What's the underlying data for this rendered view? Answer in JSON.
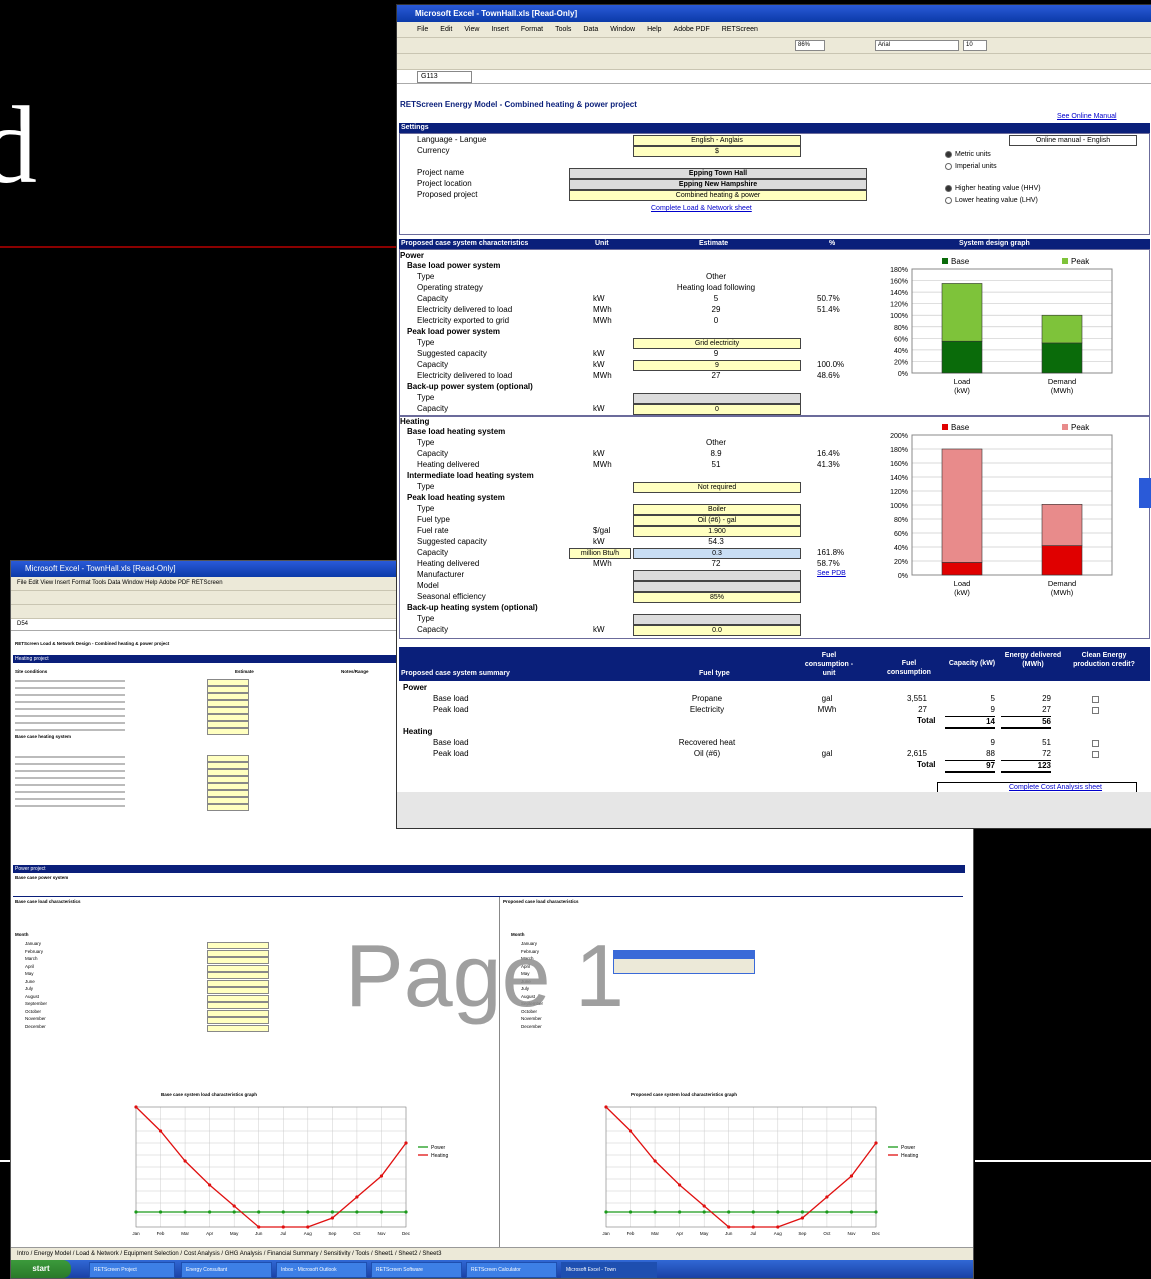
{
  "slide": {
    "letter": "d"
  },
  "front": {
    "title": "Microsoft Excel - TownHall.xls [Read-Only]",
    "menus": [
      "File",
      "Edit",
      "View",
      "Insert",
      "Format",
      "Tools",
      "Data",
      "Window",
      "Help",
      "Adobe PDF",
      "RETScreen"
    ],
    "zoom": "86%",
    "font": "Arial",
    "font_size": "10",
    "cell_ref": "G113",
    "sheet_title": "RETScreen Energy Model - Combined heating & power project",
    "online_manual_link": "See Online Manual",
    "settings": {
      "header": "Settings",
      "language_label": "Language - Langue",
      "language_value": "English - Anglais",
      "currency_label": "Currency",
      "currency_value": "$",
      "online_manual_value": "Online manual - English",
      "metric": "Metric units",
      "imperial": "Imperial units",
      "hhv": "Higher heating value (HHV)",
      "lhv": "Lower heating value (LHV)",
      "project_name_label": "Project name",
      "project_name": "Epping Town Hall",
      "project_location_label": "Project location",
      "project_location": "Epping New Hampshire",
      "proposed_project_label": "Proposed project",
      "proposed_project": "Combined heating & power",
      "complete_link": "Complete Load & Network sheet"
    },
    "characteristics": {
      "header": "Proposed case system characteristics",
      "col_unit": "Unit",
      "col_estimate": "Estimate",
      "col_pct": "%",
      "col_graph": "System design graph",
      "power_label": "Power",
      "base_power": "Base load power system",
      "type_label": "Type",
      "type_value": "Other",
      "op_strategy_label": "Operating strategy",
      "op_strategy_value": "Heating load following",
      "capacity_label": "Capacity",
      "unit_kw": "kW",
      "base_capacity": "5",
      "base_capacity_pct": "50.7%",
      "elec_delivered_label": "Electricity delivered to load",
      "unit_mwh": "MWh",
      "elec_delivered": "29",
      "elec_delivered_pct": "51.4%",
      "elec_exported_label": "Electricity exported to grid",
      "elec_exported": "0",
      "peak_power": "Peak load power system",
      "peak_type": "Grid electricity",
      "suggested_capacity_label": "Suggested capacity",
      "peak_suggested": "9",
      "peak_capacity": "9",
      "peak_capacity_pct": "100.0%",
      "peak_elec": "27",
      "peak_elec_pct": "48.6%",
      "backup_power": "Back-up power system (optional)",
      "backup_capacity": "0",
      "heating_label": "Heating",
      "base_heating": "Base load heating system",
      "base_heat_type": "Other",
      "base_heat_capacity": "8.9",
      "base_heat_capacity_pct": "16.4%",
      "heating_delivered_label": "Heating delivered",
      "base_heat_delivered": "51",
      "base_heat_delivered_pct": "41.3%",
      "intermediate_heating": "Intermediate load heating system",
      "intermediate_type": "Not required",
      "peak_heating": "Peak load heating system",
      "peak_heat_type": "Boiler",
      "fuel_type_label": "Fuel type",
      "fuel_type_value": "Oil (#6) - gal",
      "fuel_rate_label": "Fuel rate",
      "fuel_rate_unit": "$/gal",
      "fuel_rate_value": "1.900",
      "peak_heat_suggested": "54.3",
      "peak_heat_capacity_unit": "million Btu/h",
      "peak_heat_capacity": "0.3",
      "peak_heat_capacity_pct": "161.8%",
      "peak_heat_delivered": "72",
      "peak_heat_delivered_pct": "58.7%",
      "see_pdb": "See PDB",
      "manufacturer_label": "Manufacturer",
      "model_label": "Model",
      "seasonal_eff_label": "Seasonal efficiency",
      "seasonal_eff_value": "85%",
      "backup_heating": "Back-up heating system (optional)",
      "backup_heat_unit": "kW",
      "backup_heat_capacity": "0.0"
    },
    "power_chart": {
      "legend": [
        "Base",
        "Peak"
      ],
      "yticks": [
        "180%",
        "160%",
        "140%",
        "120%",
        "100%",
        "80%",
        "60%",
        "40%",
        "20%",
        "0%"
      ],
      "categories": [
        "Load\n(kW)",
        "Demand\n(MWh)"
      ],
      "cat_labels": [
        [
          "Load",
          "(kW)"
        ],
        [
          "Demand",
          "(MWh)"
        ]
      ],
      "base_pct": [
        55,
        52
      ],
      "peak_pct": [
        100,
        48
      ],
      "colors": {
        "base": "#0a6b0a",
        "peak": "#7ec33a"
      }
    },
    "heating_chart": {
      "legend": [
        "Base",
        "Peak"
      ],
      "yticks": [
        "200%",
        "180%",
        "160%",
        "140%",
        "120%",
        "100%",
        "80%",
        "60%",
        "40%",
        "20%",
        "0%"
      ],
      "cat_labels": [
        [
          "Load",
          "(kW)"
        ],
        [
          "Demand",
          "(MWh)"
        ]
      ],
      "base_pct": [
        18,
        42
      ],
      "peak_pct": [
        162,
        59
      ],
      "colors": {
        "base": "#e00000",
        "peak": "#e88b8b"
      }
    },
    "summary": {
      "header": "Proposed case system summary",
      "col_fuel_type": "Fuel type",
      "col_fuel_unit": "Fuel consumption - unit",
      "col_fuel_cons": "Fuel consumption",
      "col_capacity": "Capacity (kW)",
      "col_energy": "Energy delivered (MWh)",
      "col_clean": "Clean Energy production credit?",
      "power_label": "Power",
      "heating_label": "Heating",
      "total_label": "Total",
      "rows_power": [
        {
          "label": "Base load",
          "fuel": "Propane",
          "unit": "gal",
          "cons": "3,551",
          "cap": "5",
          "energy": "29"
        },
        {
          "label": "Peak load",
          "fuel": "Electricity",
          "unit": "MWh",
          "cons": "27",
          "cap": "9",
          "energy": "27"
        }
      ],
      "power_total": {
        "cap": "14",
        "energy": "56"
      },
      "rows_heating": [
        {
          "label": "Base load",
          "fuel": "Recovered heat",
          "unit": "",
          "cons": "",
          "cap": "9",
          "energy": "51"
        },
        {
          "label": "Peak load",
          "fuel": "Oil (#6)",
          "unit": "gal",
          "cons": "2,615",
          "cap": "88",
          "energy": "72"
        }
      ],
      "heating_total": {
        "cap": "97",
        "energy": "123"
      },
      "cost_link": "Complete Cost Analysis sheet"
    }
  },
  "back": {
    "title": "Microsoft Excel - TownHall.xls [Read-Only]",
    "cell_ref": "D54",
    "sheet_title": "RETScreen Load & Network Design - Combined heating & power project",
    "heating_project": "Heating project",
    "site_conditions": "Site conditions",
    "estimate": "Estimate",
    "notes_range": "Notes/Range",
    "base_heating_system": "Base case heating system",
    "power_project": "Power project",
    "base_power_system": "Base case power system",
    "base_load_char": "Base case load characteristics",
    "proposed_load_char": "Proposed case load characteristics",
    "month_label": "Month",
    "months": [
      "January",
      "February",
      "March",
      "April",
      "May",
      "June",
      "July",
      "August",
      "September",
      "October",
      "November",
      "December"
    ],
    "watermark": "Page 1",
    "base_graph_title": "Base case system load characteristics graph",
    "proposed_graph_title": "Proposed case system load characteristics graph",
    "legend": [
      "Power",
      "Heating"
    ],
    "month_abbr": [
      "Jan",
      "Feb",
      "Mar",
      "Apr",
      "May",
      "Jun",
      "Jul",
      "Aug",
      "Sep",
      "Oct",
      "Nov",
      "Dec"
    ],
    "line_data": {
      "power": [
        5,
        5,
        5,
        5,
        5,
        5,
        5,
        5,
        5,
        5,
        5,
        5
      ],
      "heating": [
        40,
        32,
        22,
        14,
        7,
        0,
        0,
        0,
        3,
        10,
        17,
        28
      ],
      "ymax": 40
    },
    "tabs": "Intro / Energy Model / Load & Network / Equipment Selection / Cost Analysis / GHG Analysis / Financial Summary / Sensitivity / Tools / Sheet1 / Sheet2 / Sheet3",
    "taskbar": {
      "start": "start",
      "items": [
        "RETScreen Project",
        "Energy Consultant",
        "Inbox - Microsoft Outlook",
        "RETScreen Software",
        "RETScreen Calculator",
        "Microsoft Excel - Town"
      ]
    }
  }
}
